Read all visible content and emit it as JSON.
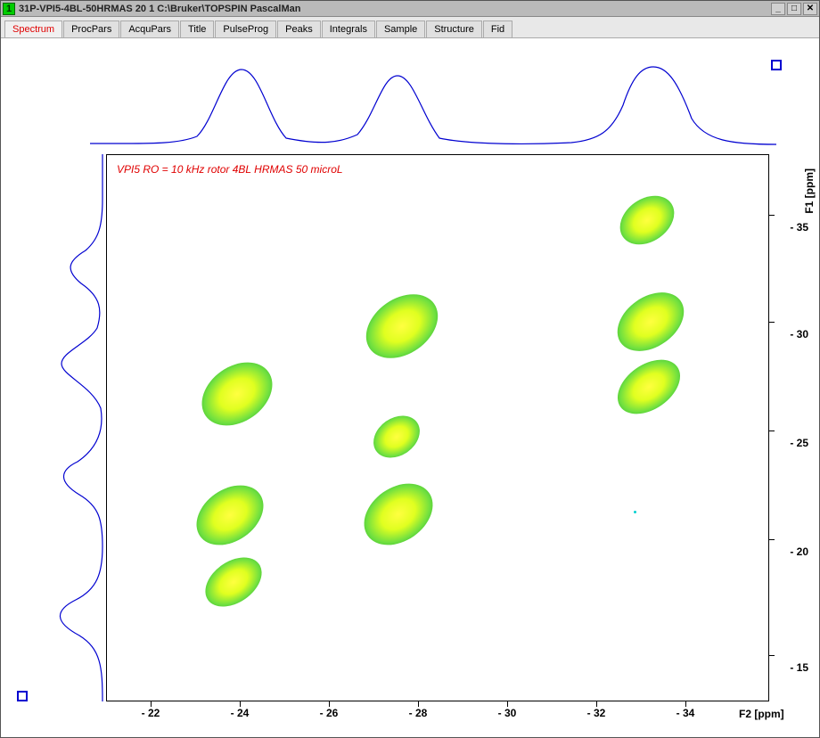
{
  "window": {
    "indexNumber": "1",
    "title": "31P-VPI5-4BL-50HRMAS  20  1  C:\\Bruker\\TOPSPIN  PascalMan"
  },
  "tabs": [
    {
      "label": "Spectrum",
      "active": true
    },
    {
      "label": "ProcPars",
      "active": false
    },
    {
      "label": "AcquPars",
      "active": false
    },
    {
      "label": "Title",
      "active": false
    },
    {
      "label": "PulseProg",
      "active": false
    },
    {
      "label": "Peaks",
      "active": false
    },
    {
      "label": "Integrals",
      "active": false
    },
    {
      "label": "Sample",
      "active": false
    },
    {
      "label": "Structure",
      "active": false
    },
    {
      "label": "Fid",
      "active": false
    }
  ],
  "plot": {
    "annotation": "VPI5 RO = 10 kHz rotor 4BL HRMAS 50 microL",
    "f2_label": "F2 [ppm]",
    "f1_label": "F1 [ppm]",
    "f2_ticks": [
      "- 22",
      "- 24",
      "- 26",
      "- 28",
      "- 30",
      "- 32",
      "- 34"
    ],
    "f1_ticks": [
      "- 15",
      "- 20",
      "- 25",
      "- 30",
      "- 35"
    ]
  },
  "chart_data": {
    "type": "heatmap",
    "title": "2D 31P-31P correlation contour plot",
    "xlabel": "F2 [ppm]",
    "ylabel": "F1 [ppm]",
    "xlim": [
      -20,
      -36
    ],
    "ylim": [
      -14,
      -38
    ],
    "f2_tick_values": [
      -22,
      -24,
      -26,
      -28,
      -30,
      -32,
      -34
    ],
    "f1_tick_values": [
      -15,
      -20,
      -25,
      -30,
      -35
    ],
    "peaks": [
      {
        "f2": -24.0,
        "f1": -18.5,
        "size": 1.0
      },
      {
        "f2": -24.3,
        "f1": -22.0,
        "size": 1.1
      },
      {
        "f2": -24.7,
        "f1": -28.0,
        "size": 1.1
      },
      {
        "f2": -27.8,
        "f1": -22.0,
        "size": 1.0
      },
      {
        "f2": -27.7,
        "f1": -26.0,
        "size": 0.7
      },
      {
        "f2": -28.0,
        "f1": -32.0,
        "size": 1.1
      },
      {
        "f2": -33.7,
        "f1": -28.5,
        "size": 1.0
      },
      {
        "f2": -33.8,
        "f1": -32.0,
        "size": 1.0
      },
      {
        "f2": -33.5,
        "f1": -36.7,
        "size": 0.9
      }
    ],
    "top_projection_peaks_f2": [
      -24.5,
      -27.8,
      -33.6
    ],
    "left_projection_peaks_f1": [
      -18.5,
      -22.0,
      -26.5,
      -28.0,
      -32.0,
      -36.5
    ]
  }
}
